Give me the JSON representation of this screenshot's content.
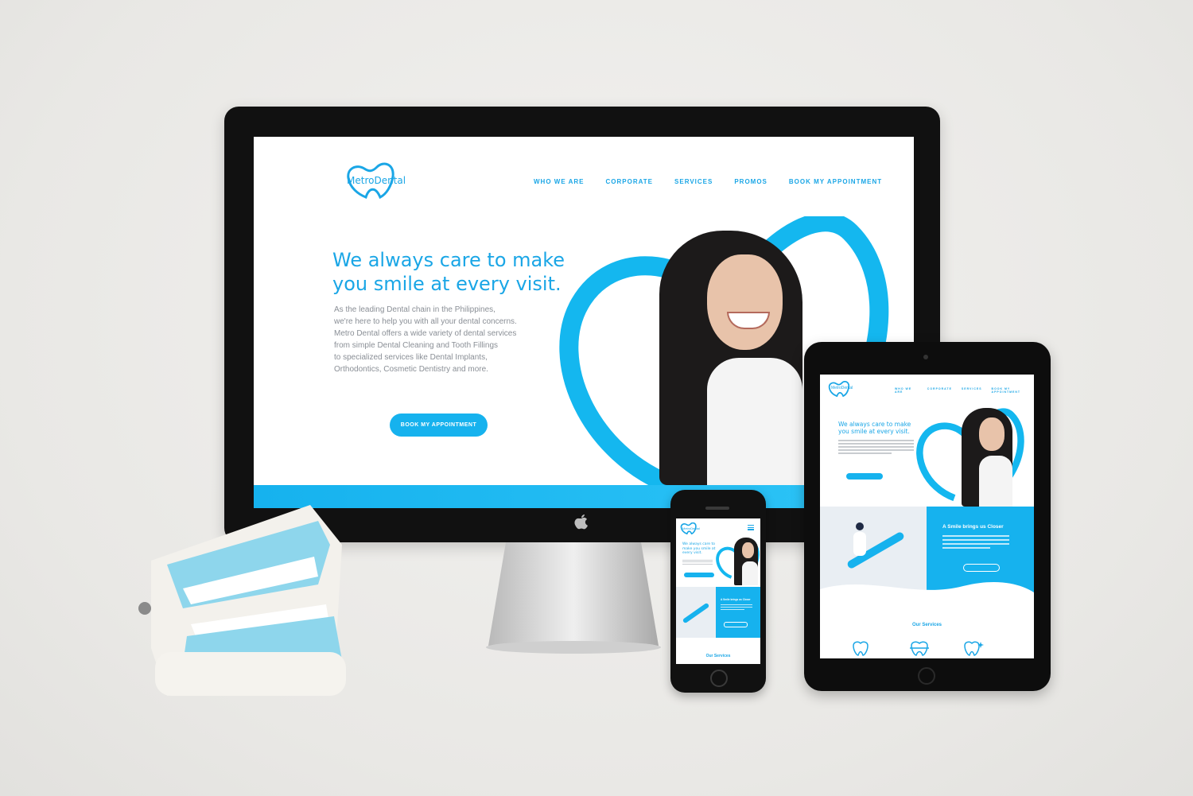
{
  "brand": {
    "logo_text": "MetroDental",
    "accent": "#1aa6e6",
    "accent_bright": "#16b2ee"
  },
  "desktop": {
    "nav": [
      "WHO WE ARE",
      "CORPORATE",
      "SERVICES",
      "PROMOS",
      "BOOK MY APPOINTMENT"
    ],
    "hero_line1": "We always care to make",
    "hero_line2": "you smile at every visit.",
    "body_lines": [
      "As the leading Dental chain in the Philippines,",
      "we're here to help you with all your dental concerns.",
      "Metro Dental offers a wide variety of dental services",
      "from simple Dental Cleaning and Tooth Fillings",
      "to specialized services like Dental Implants,",
      "Orthodontics, Cosmetic Dentistry and more."
    ],
    "cta": "BOOK MY APPOINTMENT"
  },
  "tablet": {
    "nav": [
      "WHO WE ARE",
      "CORPORATE",
      "SERVICES",
      "BOOK MY APPOINTMENT"
    ],
    "hero_line1": "We always care to make",
    "hero_line2": "you smile at every visit.",
    "section_title": "A Smile brings us Closer",
    "services_title": "Our Services"
  },
  "phone": {
    "hero_line1": "We always care to",
    "hero_line2": "make you smile at",
    "hero_line3": "every visit.",
    "section_title": "A Smile brings us Closer",
    "services_title": "Our Services"
  },
  "icons": [
    "tooth-logo-icon",
    "apple-logo-icon",
    "hamburger-menu-icon",
    "tooth-service-icon",
    "braces-service-icon",
    "sparkle-tooth-service-icon"
  ]
}
